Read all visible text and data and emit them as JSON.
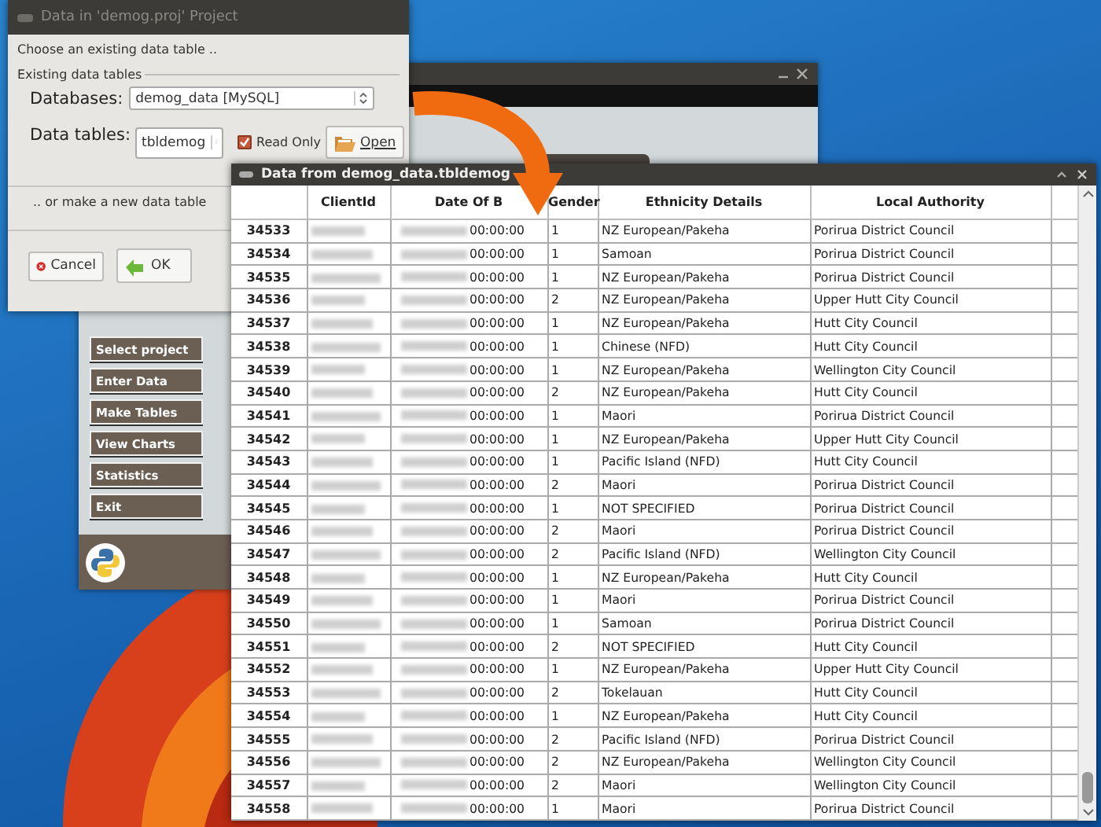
{
  "main_window": {
    "menu_buttons": [
      "Select project",
      "Enter Data",
      "Make Tables",
      "View Charts",
      "Statistics",
      "Exit"
    ]
  },
  "dialog": {
    "title": "Data in 'demog.proj' Project",
    "prompt": "Choose an existing data table ..",
    "group_title": "Existing data tables",
    "databases_label": "Databases:",
    "database_value": "demog_data [MySQL]",
    "tables_label": "Data tables:",
    "table_value": "tbldemog",
    "read_only": {
      "label": "Read Only",
      "checked": true
    },
    "open_button": "Open",
    "new_table_prompt": ".. or make a new data table",
    "cancel_button": "Cancel",
    "ok_button": "OK"
  },
  "table_window": {
    "title": "Data from demog_data.tbldemog",
    "columns": [
      "ClientId",
      "Date Of B",
      "Gender",
      "Ethnicity Details",
      "Local Authority"
    ],
    "rows": [
      {
        "header": "34533",
        "time": "00:00:00",
        "gender": "1",
        "ethnicity": "NZ European/Pakeha",
        "authority": "Porirua District Council"
      },
      {
        "header": "34534",
        "time": "00:00:00",
        "gender": "1",
        "ethnicity": "Samoan",
        "authority": "Porirua District Council"
      },
      {
        "header": "34535",
        "time": "00:00:00",
        "gender": "1",
        "ethnicity": "NZ European/Pakeha",
        "authority": "Porirua District Council"
      },
      {
        "header": "34536",
        "time": "00:00:00",
        "gender": "2",
        "ethnicity": "NZ European/Pakeha",
        "authority": "Upper Hutt City Council"
      },
      {
        "header": "34537",
        "time": "00:00:00",
        "gender": "1",
        "ethnicity": "NZ European/Pakeha",
        "authority": "Hutt City Council"
      },
      {
        "header": "34538",
        "time": "00:00:00",
        "gender": "1",
        "ethnicity": "Chinese (NFD)",
        "authority": "Hutt City Council"
      },
      {
        "header": "34539",
        "time": "00:00:00",
        "gender": "1",
        "ethnicity": "NZ European/Pakeha",
        "authority": "Wellington City Council"
      },
      {
        "header": "34540",
        "time": "00:00:00",
        "gender": "2",
        "ethnicity": "NZ European/Pakeha",
        "authority": "Hutt City Council"
      },
      {
        "header": "34541",
        "time": "00:00:00",
        "gender": "1",
        "ethnicity": "Maori",
        "authority": "Porirua District Council"
      },
      {
        "header": "34542",
        "time": "00:00:00",
        "gender": "1",
        "ethnicity": "NZ European/Pakeha",
        "authority": "Upper Hutt City Council"
      },
      {
        "header": "34543",
        "time": "00:00:00",
        "gender": "1",
        "ethnicity": "Pacific Island (NFD)",
        "authority": "Hutt City Council"
      },
      {
        "header": "34544",
        "time": "00:00:00",
        "gender": "2",
        "ethnicity": "Maori",
        "authority": "Porirua District Council"
      },
      {
        "header": "34545",
        "time": "00:00:00",
        "gender": "1",
        "ethnicity": "NOT SPECIFIED",
        "authority": "Porirua District Council"
      },
      {
        "header": "34546",
        "time": "00:00:00",
        "gender": "2",
        "ethnicity": "Maori",
        "authority": "Porirua District Council"
      },
      {
        "header": "34547",
        "time": "00:00:00",
        "gender": "2",
        "ethnicity": "Pacific Island (NFD)",
        "authority": "Wellington City Council"
      },
      {
        "header": "34548",
        "time": "00:00:00",
        "gender": "1",
        "ethnicity": "NZ European/Pakeha",
        "authority": "Hutt City Council"
      },
      {
        "header": "34549",
        "time": "00:00:00",
        "gender": "1",
        "ethnicity": "Maori",
        "authority": "Porirua District Council"
      },
      {
        "header": "34550",
        "time": "00:00:00",
        "gender": "1",
        "ethnicity": "Samoan",
        "authority": "Porirua District Council"
      },
      {
        "header": "34551",
        "time": "00:00:00",
        "gender": "2",
        "ethnicity": "NOT SPECIFIED",
        "authority": "Hutt City Council"
      },
      {
        "header": "34552",
        "time": "00:00:00",
        "gender": "1",
        "ethnicity": "NZ European/Pakeha",
        "authority": "Upper Hutt City Council"
      },
      {
        "header": "34553",
        "time": "00:00:00",
        "gender": "2",
        "ethnicity": "Tokelauan",
        "authority": "Hutt City Council"
      },
      {
        "header": "34554",
        "time": "00:00:00",
        "gender": "1",
        "ethnicity": "NZ European/Pakeha",
        "authority": "Hutt City Council"
      },
      {
        "header": "34555",
        "time": "00:00:00",
        "gender": "2",
        "ethnicity": "Pacific Island (NFD)",
        "authority": "Porirua District Council"
      },
      {
        "header": "34556",
        "time": "00:00:00",
        "gender": "2",
        "ethnicity": "NZ European/Pakeha",
        "authority": "Wellington City Council"
      },
      {
        "header": "34557",
        "time": "00:00:00",
        "gender": "2",
        "ethnicity": "Maori",
        "authority": "Wellington City Council"
      },
      {
        "header": "34558",
        "time": "00:00:00",
        "gender": "1",
        "ethnicity": "Maori",
        "authority": "Porirua District Council"
      }
    ]
  }
}
